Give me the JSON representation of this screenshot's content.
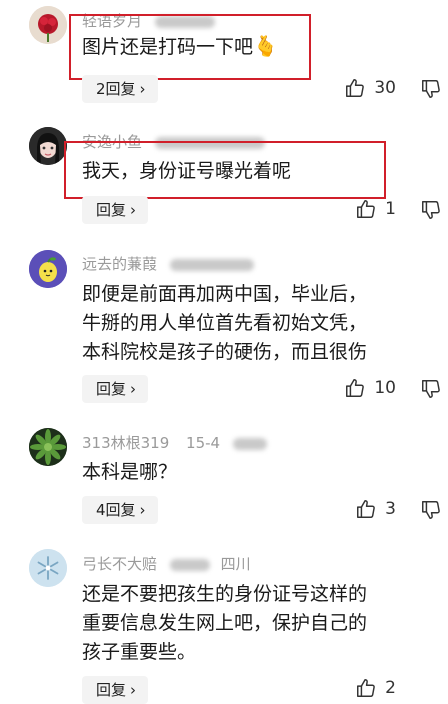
{
  "comments": [
    {
      "username": "轻语岁月",
      "meta": "",
      "lines": [
        "图片还是打码一下吧"
      ],
      "emoji": "🫰",
      "reply_label": "2回复",
      "likes": "30",
      "avatar_icon": "red-flower-icon"
    },
    {
      "username": "安逸小鱼",
      "meta": "",
      "lines": [
        "我天，身份证号曝光着呢"
      ],
      "reply_label": "回复",
      "likes": "1",
      "avatar_icon": "girl-portrait-icon"
    },
    {
      "username": "远去的蒹葭",
      "meta": "",
      "lines": [
        "即便是前面再加两中国，毕业后，",
        "牛掰的用人单位首先看初始文凭，",
        "本科院校是孩子的硬伤，而且很伤"
      ],
      "reply_label": "回复",
      "likes": "10",
      "avatar_icon": "lemon-cartoon-icon"
    },
    {
      "username": "313林根319",
      "meta": "15-4",
      "lines": [
        "本科是哪？"
      ],
      "reply_label": "4回复",
      "likes": "3",
      "avatar_icon": "succulent-plant-icon"
    },
    {
      "username": "弓长不大赔",
      "meta": "四川",
      "lines": [
        "还是不要把孩生的身份证号这样的",
        "重要信息发生网上吧，保护自己的",
        "孩子重要些。"
      ],
      "reply_label": "回复",
      "likes": "2",
      "avatar_icon": "snowflake-icon"
    }
  ],
  "colors": {
    "highlight": "#d11f2a",
    "meta": "#9a9a9a",
    "reply_bg": "#f3f3f3"
  }
}
